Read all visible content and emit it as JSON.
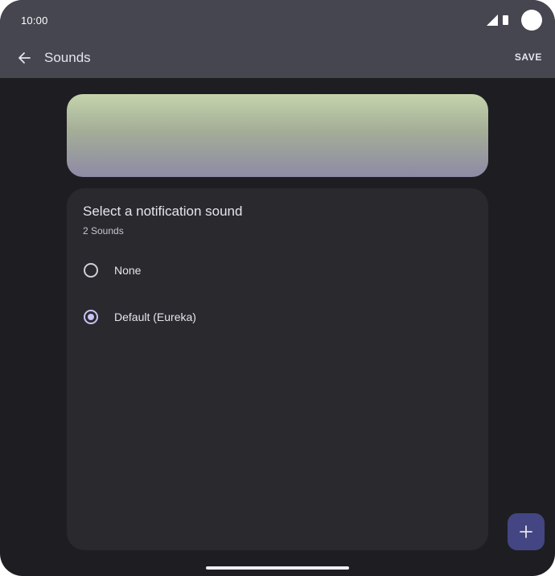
{
  "status_bar": {
    "time": "10:00",
    "icons": [
      "signal-icon",
      "battery-icon",
      "camera-cutout"
    ]
  },
  "app_bar": {
    "back_icon": "arrow-back-icon",
    "title": "Sounds",
    "save_label": "SAVE"
  },
  "sound_picker": {
    "title": "Select a notification sound",
    "subtitle": "2 Sounds",
    "options": [
      {
        "label": "None",
        "selected": false
      },
      {
        "label": "Default (Eureka)",
        "selected": true
      }
    ]
  },
  "fab": {
    "icon": "plus-icon"
  },
  "colors": {
    "app_bar": "#45464f",
    "background": "#1e1e22",
    "card": "#2a292e",
    "accent": "#c6c3f4",
    "fab": "#434682"
  }
}
